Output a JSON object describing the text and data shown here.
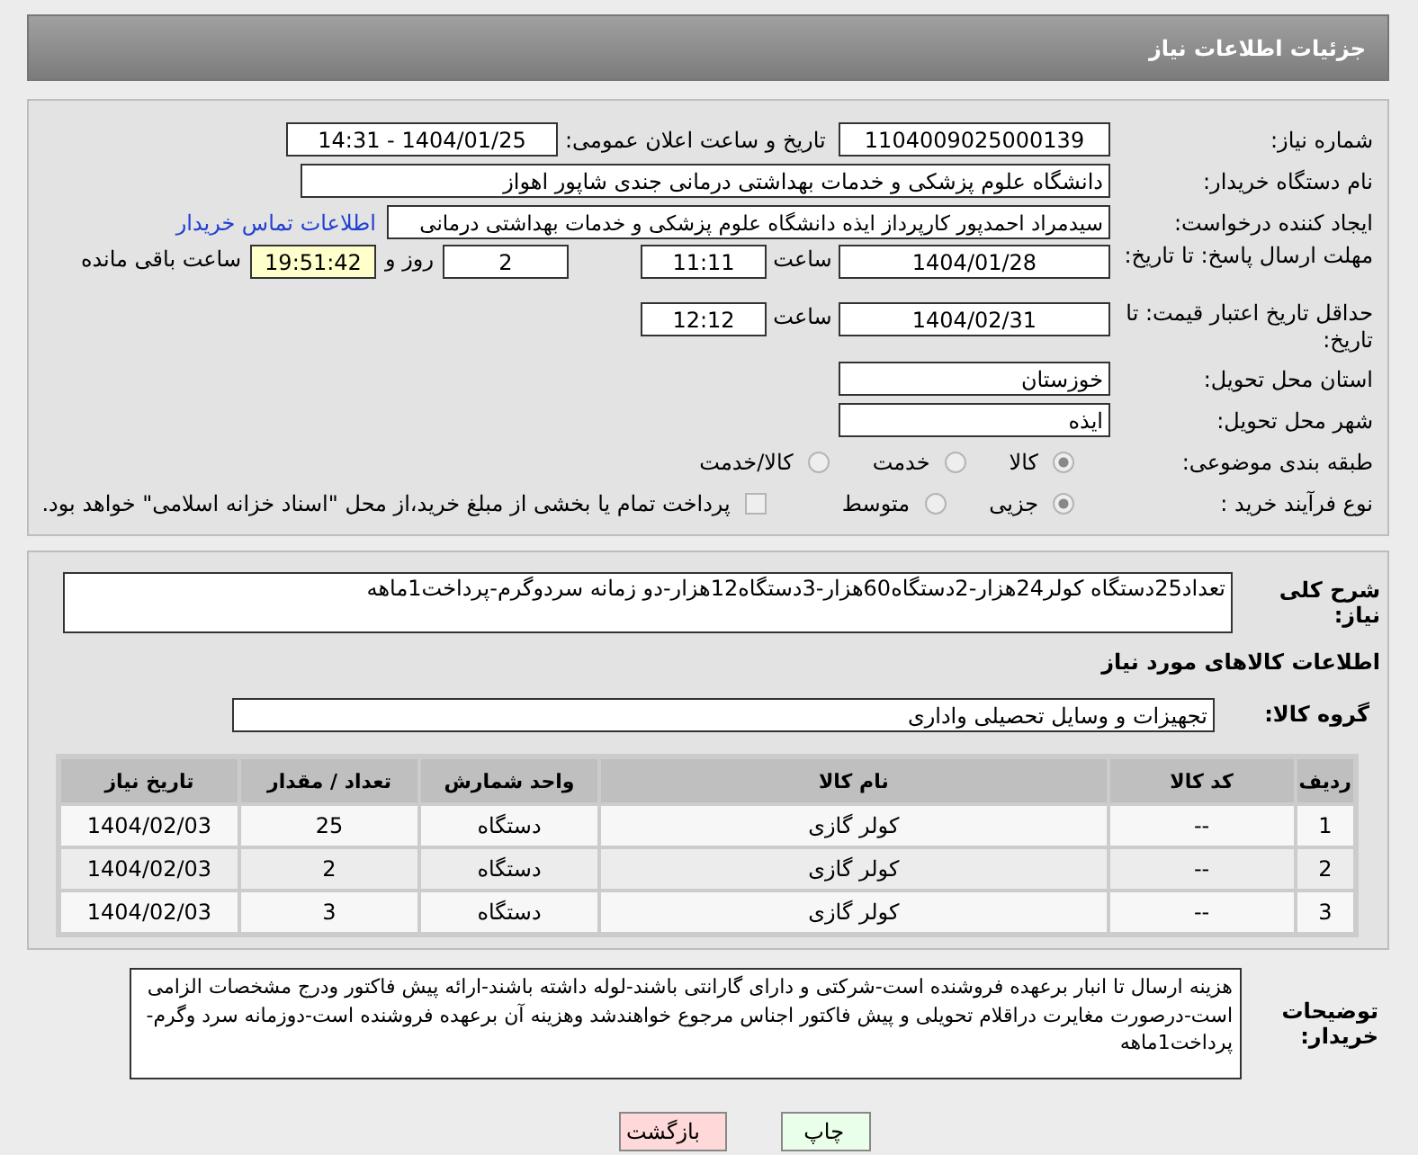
{
  "header": {
    "title": "جزئیات اطلاعات نیاز"
  },
  "need_number": {
    "label": "شماره نیاز:",
    "value": "1104009025000139"
  },
  "announce": {
    "label": "تاریخ و ساعت اعلان عمومی:",
    "value": "1404/01/25 - 14:31"
  },
  "buyer": {
    "label": "نام دستگاه خریدار:",
    "value": "دانشگاه علوم پزشکی و خدمات بهداشتی درمانی جندی شاپور اهواز"
  },
  "requester": {
    "label": "ایجاد کننده درخواست:",
    "value": "سیدمراد احمدپور کارپرداز ایذه دانشگاه علوم پزشکی و خدمات بهداشتی درمانی",
    "link": "اطلاعات تماس خریدار"
  },
  "deadline": {
    "label": "مهلت ارسال پاسخ: تا تاریخ:",
    "date": "1404/01/28",
    "time_label": "ساعت",
    "time": "11:11",
    "days": "2",
    "days_label": "روز و",
    "remaining": "19:51:42",
    "remaining_label": "ساعت باقی مانده"
  },
  "validity": {
    "label": "حداقل تاریخ اعتبار قیمت: تا تاریخ:",
    "date": "1404/02/31",
    "time_label": "ساعت",
    "time": "12:12"
  },
  "province": {
    "label": "استان محل تحویل:",
    "value": "خوزستان"
  },
  "city": {
    "label": "شهر محل تحویل:",
    "value": "ایذه"
  },
  "category": {
    "label": "طبقه بندی موضوعی:",
    "options": [
      {
        "label": "کالا",
        "selected": true
      },
      {
        "label": "خدمت",
        "selected": false
      },
      {
        "label": "کالا/خدمت",
        "selected": false
      }
    ]
  },
  "process": {
    "label": "نوع فرآیند خرید :",
    "options": [
      {
        "label": "جزیی",
        "selected": true
      },
      {
        "label": "متوسط",
        "selected": false
      }
    ],
    "payment": {
      "label": "پرداخت تمام یا بخشی از مبلغ خرید،از محل \"اسناد خزانه اسلامی\" خواهد بود.",
      "checked": false
    }
  },
  "summary": {
    "label": "شرح کلی نیاز:",
    "value": "تعداد25دستگاه کولر24هزار-2دستگاه60هزار-3دستگاه12هزار-دو زمانه سردوگرم-پرداخت1ماهه"
  },
  "goods_heading": "اطلاعات کالاهای مورد نیاز",
  "goods_group": {
    "label": "گروه کالا:",
    "value": "تجهیزات و وسایل تحصیلی واداری"
  },
  "table": {
    "columns": [
      "ردیف",
      "کد کالا",
      "نام کالا",
      "واحد شمارش",
      "تعداد / مقدار",
      "تاریخ نیاز"
    ],
    "rows": [
      [
        "1",
        "--",
        "کولر گازی",
        "دستگاه",
        "25",
        "1404/02/03"
      ],
      [
        "2",
        "--",
        "کولر گازی",
        "دستگاه",
        "2",
        "1404/02/03"
      ],
      [
        "3",
        "--",
        "کولر گازی",
        "دستگاه",
        "3",
        "1404/02/03"
      ]
    ]
  },
  "notes": {
    "label": "توضیحات خریدار:",
    "value": "هزینه ارسال تا انبار برعهده فروشنده است-شرکتی و دارای گارانتی باشند-لوله داشته باشند-ارائه پیش فاکتور ودرج مشخصات الزامی است-درصورت مغایرت دراقلام تحویلی و پیش فاکتور اجناس مرجوع خواهندشد وهزینه آن برعهده فروشنده است-دوزمانه سرد وگرم-پرداخت1ماهه"
  },
  "buttons": [
    {
      "label": "چاپ",
      "kind": "print"
    },
    {
      "label": "بازگشت",
      "kind": "back"
    }
  ]
}
